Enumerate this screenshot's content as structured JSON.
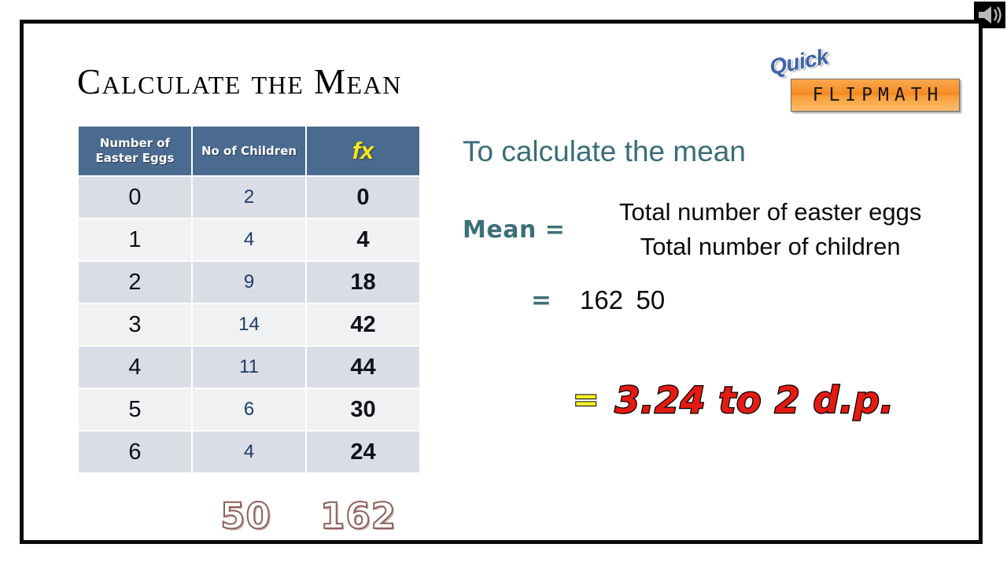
{
  "player": {
    "speaker_icon": "speaker-volume-icon"
  },
  "slide": {
    "title": "Calculate the Mean",
    "logo": {
      "quick_text": "Quick",
      "brand_text": "FLIPMATH",
      "box_color": "#f58a20",
      "quick_color": "#3b63a8"
    },
    "table": {
      "headers": [
        "Number of Easter Eggs",
        "No of Children",
        "fx"
      ],
      "header_bg": "#4a6a90",
      "fx_color": "#ffe916",
      "rows": [
        {
          "eggs": "0",
          "children": "2",
          "fx": "0"
        },
        {
          "eggs": "1",
          "children": "4",
          "fx": "4"
        },
        {
          "eggs": "2",
          "children": "9",
          "fx": "18"
        },
        {
          "eggs": "3",
          "children": "14",
          "fx": "42"
        },
        {
          "eggs": "4",
          "children": "11",
          "fx": "44"
        },
        {
          "eggs": "5",
          "children": "6",
          "fx": "30"
        },
        {
          "eggs": "6",
          "children": "4",
          "fx": "24"
        }
      ],
      "totals": {
        "eggs_total": "",
        "children_total": "50",
        "fx_total": "162"
      }
    },
    "explanation": {
      "heading": "To calculate the mean",
      "heading_color": "#3a6d78",
      "mean_label": "Mean =",
      "formula_numerator": "Total number of easter eggs",
      "formula_denominator": "Total number of children",
      "numeric_equals": "=",
      "numeric_numerator": "162",
      "numeric_denominator": "50",
      "answer_equals": "=",
      "answer_text": "3.24 to 2 d.p.",
      "answer_color": "#e31b13",
      "answer_equals_color": "#f5f02a"
    }
  },
  "chart_data": {
    "type": "table",
    "title": "Calculate the Mean",
    "columns": [
      "Number of Easter Eggs",
      "No of Children",
      "fx"
    ],
    "rows": [
      [
        0,
        2,
        0
      ],
      [
        1,
        4,
        4
      ],
      [
        2,
        9,
        18
      ],
      [
        3,
        14,
        42
      ],
      [
        4,
        11,
        44
      ],
      [
        5,
        6,
        30
      ],
      [
        6,
        4,
        24
      ]
    ],
    "totals": [
      null,
      50,
      162
    ],
    "derived": {
      "mean_expression": "162 / 50",
      "mean_value": 3.24,
      "rounding": "2 d.p."
    }
  }
}
